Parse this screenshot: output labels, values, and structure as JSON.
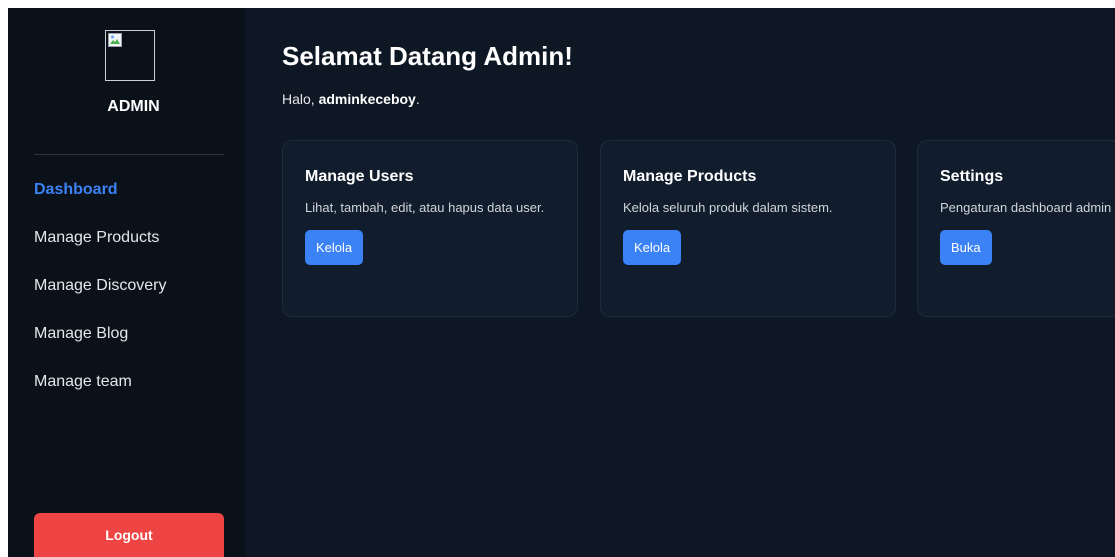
{
  "sidebar": {
    "title": "ADMIN",
    "logo_icon": "broken-image-icon",
    "items": [
      {
        "label": "Dashboard",
        "active": true
      },
      {
        "label": "Manage Products",
        "active": false
      },
      {
        "label": "Manage Discovery",
        "active": false
      },
      {
        "label": "Manage Blog",
        "active": false
      },
      {
        "label": "Manage team",
        "active": false
      }
    ],
    "logout_label": "Logout"
  },
  "main": {
    "welcome": "Selamat Datang Admin!",
    "greeting_prefix": "Halo, ",
    "username": "adminkeceboy",
    "greeting_suffix": ".",
    "cards": [
      {
        "title": "Manage Users",
        "description": "Lihat, tambah, edit, atau hapus data user.",
        "button": "Kelola"
      },
      {
        "title": "Manage Products",
        "description": "Kelola seluruh produk dalam sistem.",
        "button": "Kelola"
      },
      {
        "title": "Settings",
        "description": "Pengaturan dashboard admin",
        "button": "Buka"
      }
    ]
  },
  "colors": {
    "accent": "#3b82f6",
    "danger": "#ef4444",
    "background": "#0e1724",
    "sidebar": "#0b1119",
    "card": "#111c2c"
  }
}
